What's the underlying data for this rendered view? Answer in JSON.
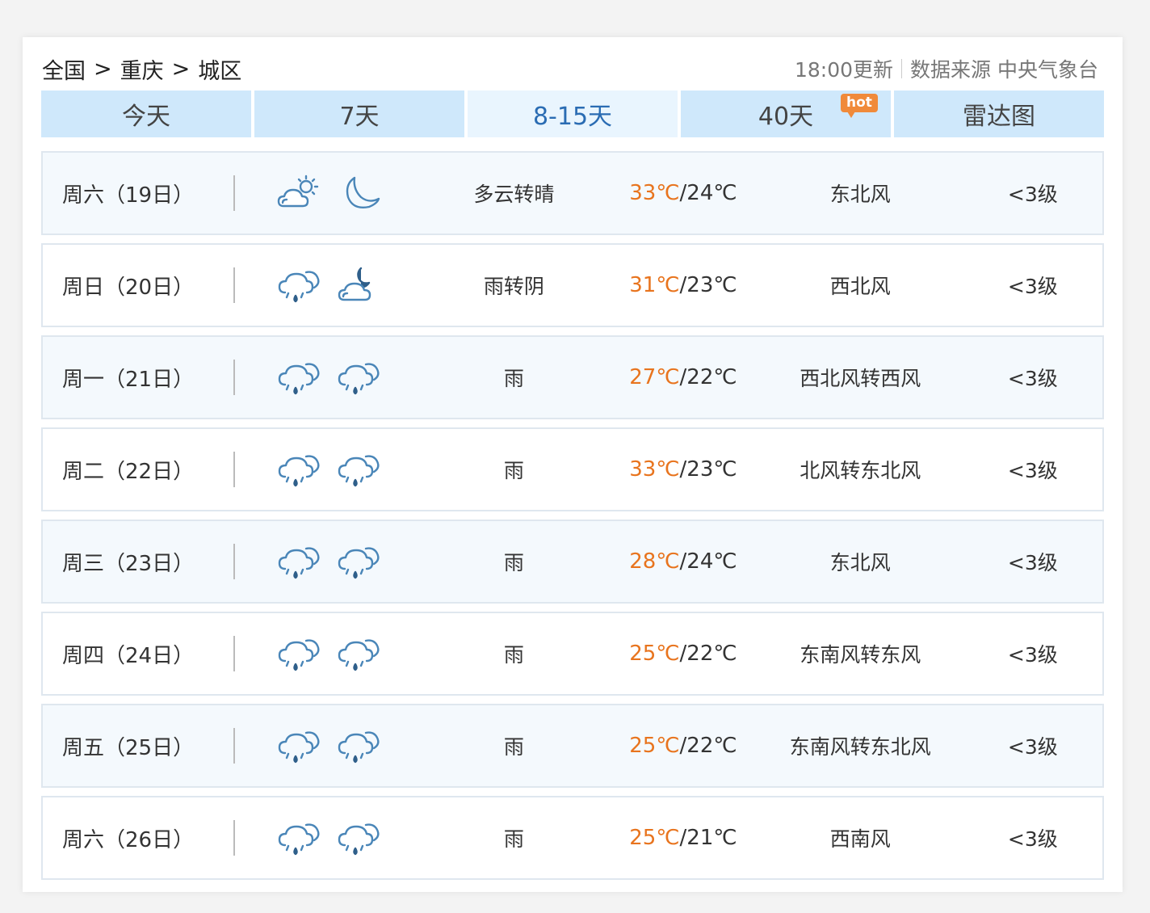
{
  "breadcrumb": {
    "country": "全国",
    "province": "重庆",
    "district": "城区",
    "separator": ">"
  },
  "meta": {
    "update": "18:00更新",
    "source": "数据来源 中央气象台"
  },
  "tabs": [
    {
      "label": "今天"
    },
    {
      "label": "7天"
    },
    {
      "label": "8-15天",
      "active": true
    },
    {
      "label": "40天",
      "badge": "hot"
    },
    {
      "label": "雷达图"
    }
  ],
  "forecast": [
    {
      "day": "周六（19日）",
      "icons": [
        "partly-cloudy-sun-icon",
        "moon-icon"
      ],
      "desc": "多云转晴",
      "high": "33℃",
      "low": "/24℃",
      "wind": "东北风",
      "level": "<3级"
    },
    {
      "day": "周日（20日）",
      "icons": [
        "rain-icon",
        "partly-cloudy-night-icon"
      ],
      "desc": "雨转阴",
      "high": "31℃",
      "low": "/23℃",
      "wind": "西北风",
      "level": "<3级"
    },
    {
      "day": "周一（21日）",
      "icons": [
        "rain-icon",
        "rain-icon"
      ],
      "desc": "雨",
      "high": "27℃",
      "low": "/22℃",
      "wind": "西北风转西风",
      "level": "<3级"
    },
    {
      "day": "周二（22日）",
      "icons": [
        "rain-icon",
        "rain-icon"
      ],
      "desc": "雨",
      "high": "33℃",
      "low": "/23℃",
      "wind": "北风转东北风",
      "level": "<3级"
    },
    {
      "day": "周三（23日）",
      "icons": [
        "rain-icon",
        "rain-icon"
      ],
      "desc": "雨",
      "high": "28℃",
      "low": "/24℃",
      "wind": "东北风",
      "level": "<3级"
    },
    {
      "day": "周四（24日）",
      "icons": [
        "rain-icon",
        "rain-icon"
      ],
      "desc": "雨",
      "high": "25℃",
      "low": "/22℃",
      "wind": "东南风转东风",
      "level": "<3级"
    },
    {
      "day": "周五（25日）",
      "icons": [
        "rain-icon",
        "rain-icon"
      ],
      "desc": "雨",
      "high": "25℃",
      "low": "/22℃",
      "wind": "东南风转东北风",
      "level": "<3级"
    },
    {
      "day": "周六（26日）",
      "icons": [
        "rain-icon",
        "rain-icon"
      ],
      "desc": "雨",
      "high": "25℃",
      "low": "/21℃",
      "wind": "西南风",
      "level": "<3级"
    }
  ],
  "colors": {
    "tab_bg": "#cfe8fb",
    "tab_active_bg": "#e9f5fe",
    "active_text": "#2a6cb3",
    "high_temp": "#e8741e",
    "icon_stroke": "#4a86b8"
  }
}
